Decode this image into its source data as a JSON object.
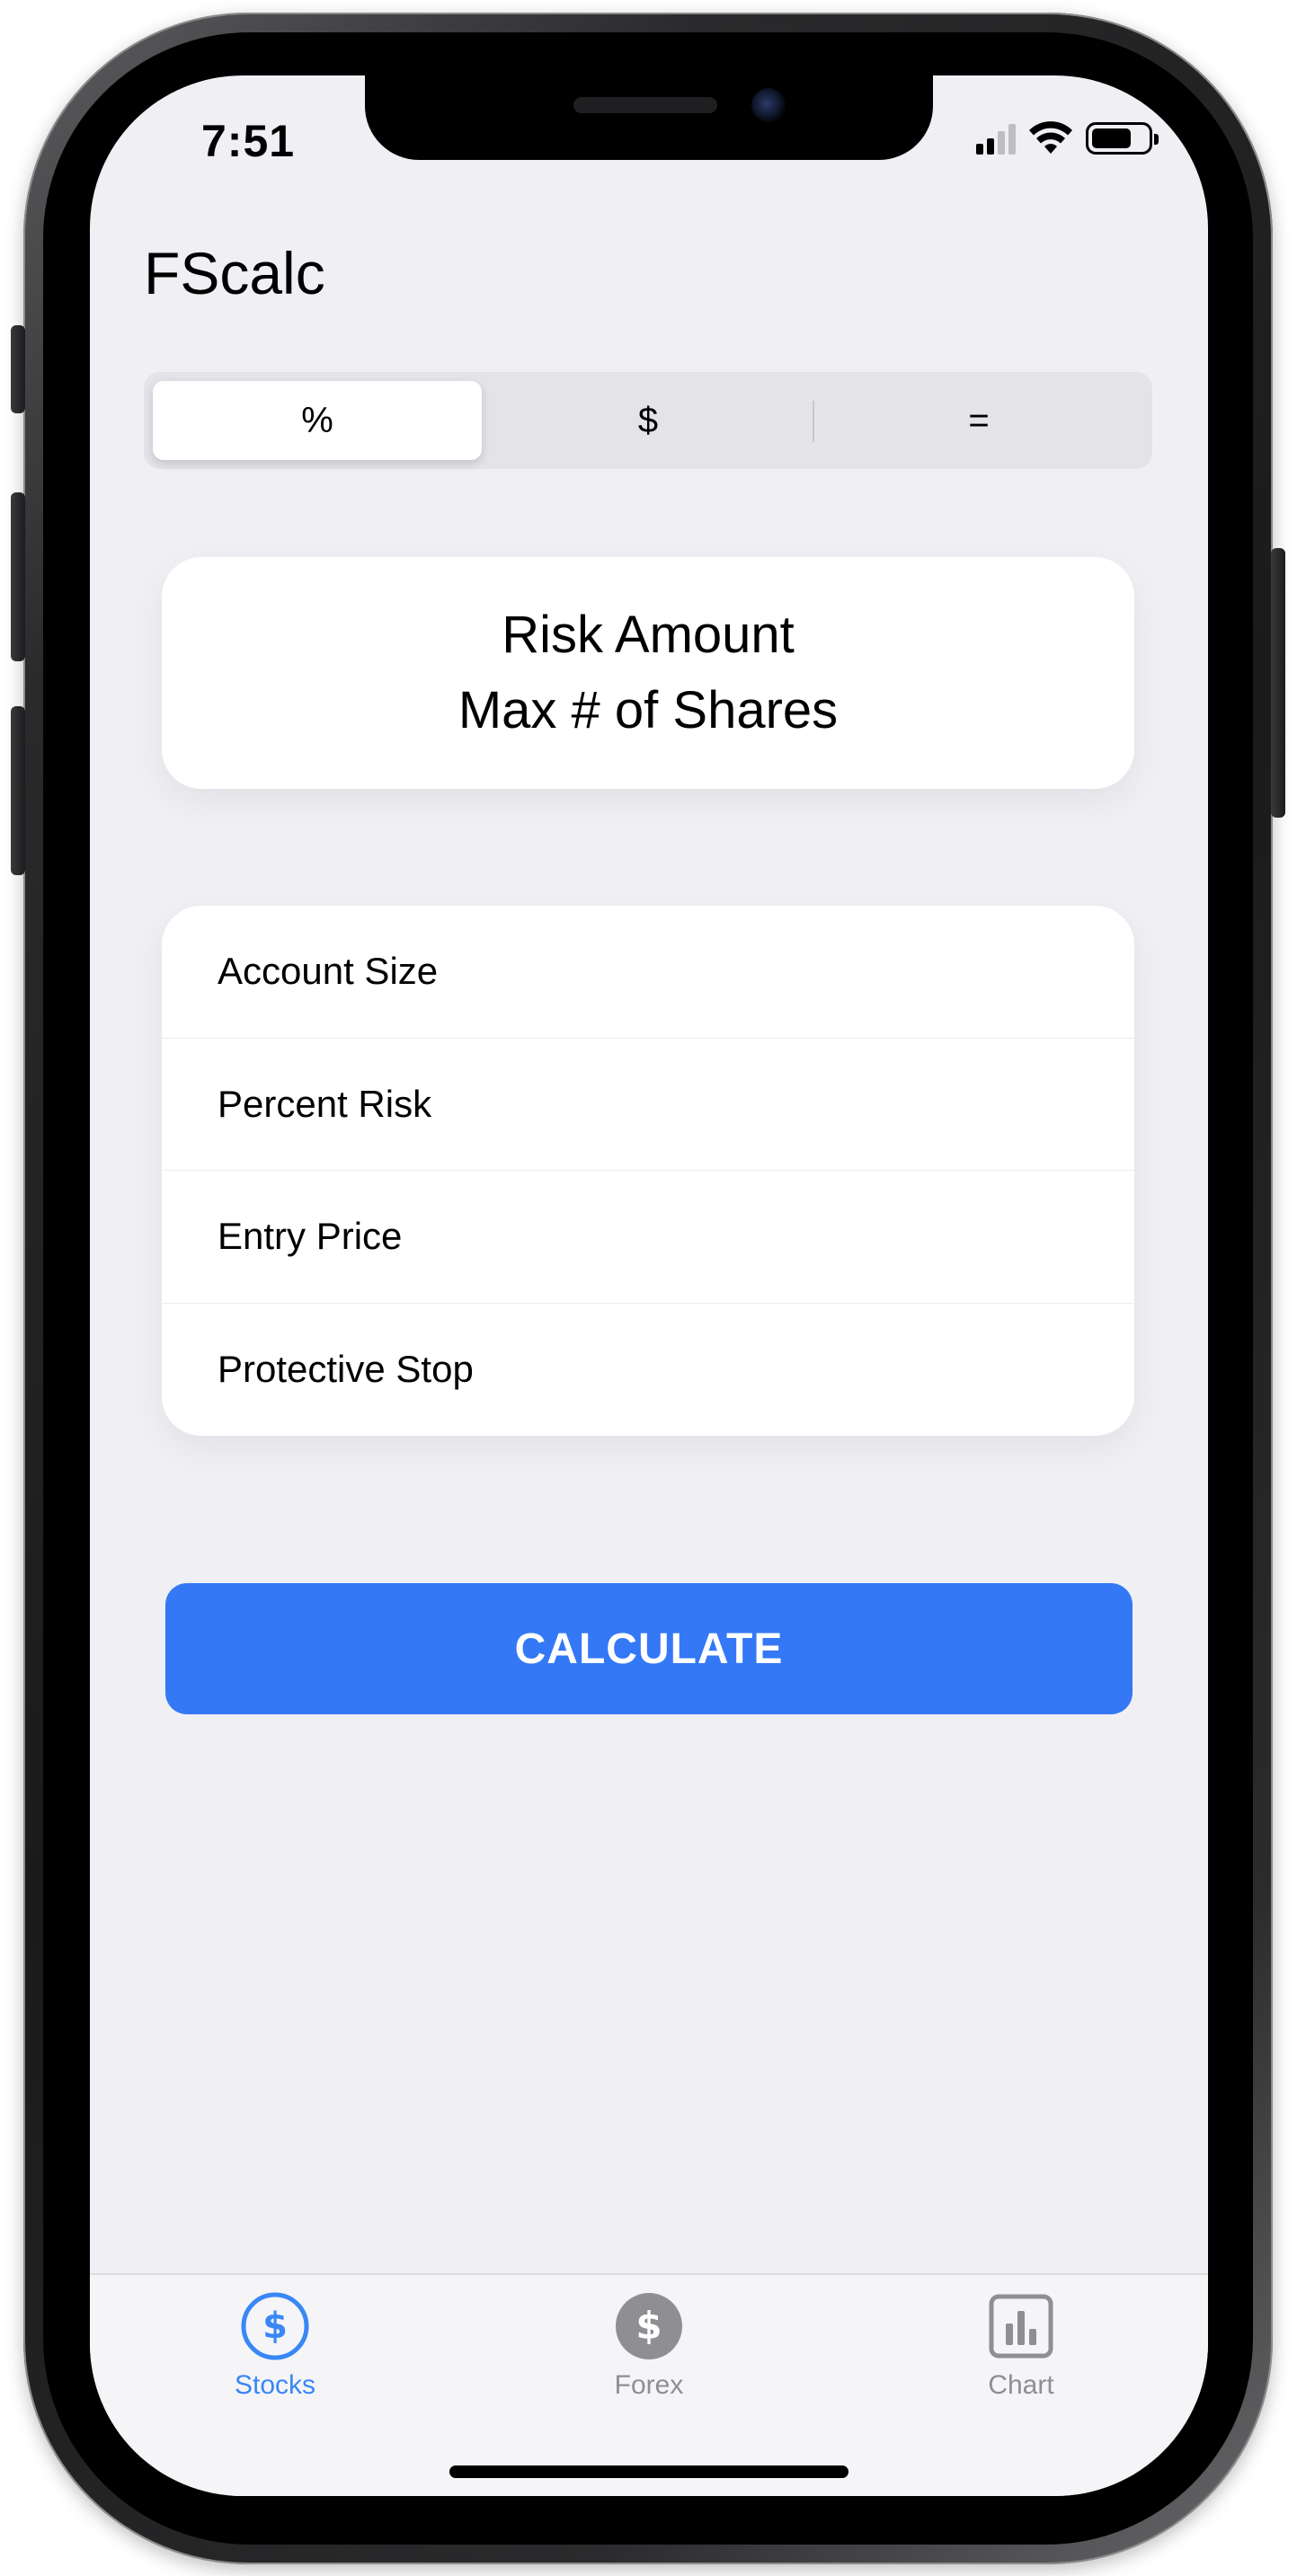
{
  "status_bar": {
    "time": "7:51"
  },
  "app": {
    "title": "FScalc"
  },
  "segmented_control": {
    "segments": [
      "%",
      "$",
      "="
    ],
    "selected": "%"
  },
  "result": {
    "line1": "Risk Amount",
    "line2": "Max # of Shares"
  },
  "form": {
    "fields": [
      {
        "placeholder": "Account Size",
        "value": ""
      },
      {
        "placeholder": "Percent Risk",
        "value": ""
      },
      {
        "placeholder": "Entry Price",
        "value": ""
      },
      {
        "placeholder": "Protective Stop",
        "value": ""
      }
    ]
  },
  "calculate_button": {
    "label": "CALCULATE",
    "color": "#3478f6"
  },
  "tab_bar": {
    "tabs": [
      {
        "label": "Stocks",
        "icon": "dollar-circle-icon",
        "active": true
      },
      {
        "label": "Forex",
        "icon": "dollar-circle-filled-icon",
        "active": false
      },
      {
        "label": "Chart",
        "icon": "bar-chart-icon",
        "active": false
      }
    ],
    "active_color": "#3a87f6",
    "inactive_color": "#8e8e93"
  }
}
